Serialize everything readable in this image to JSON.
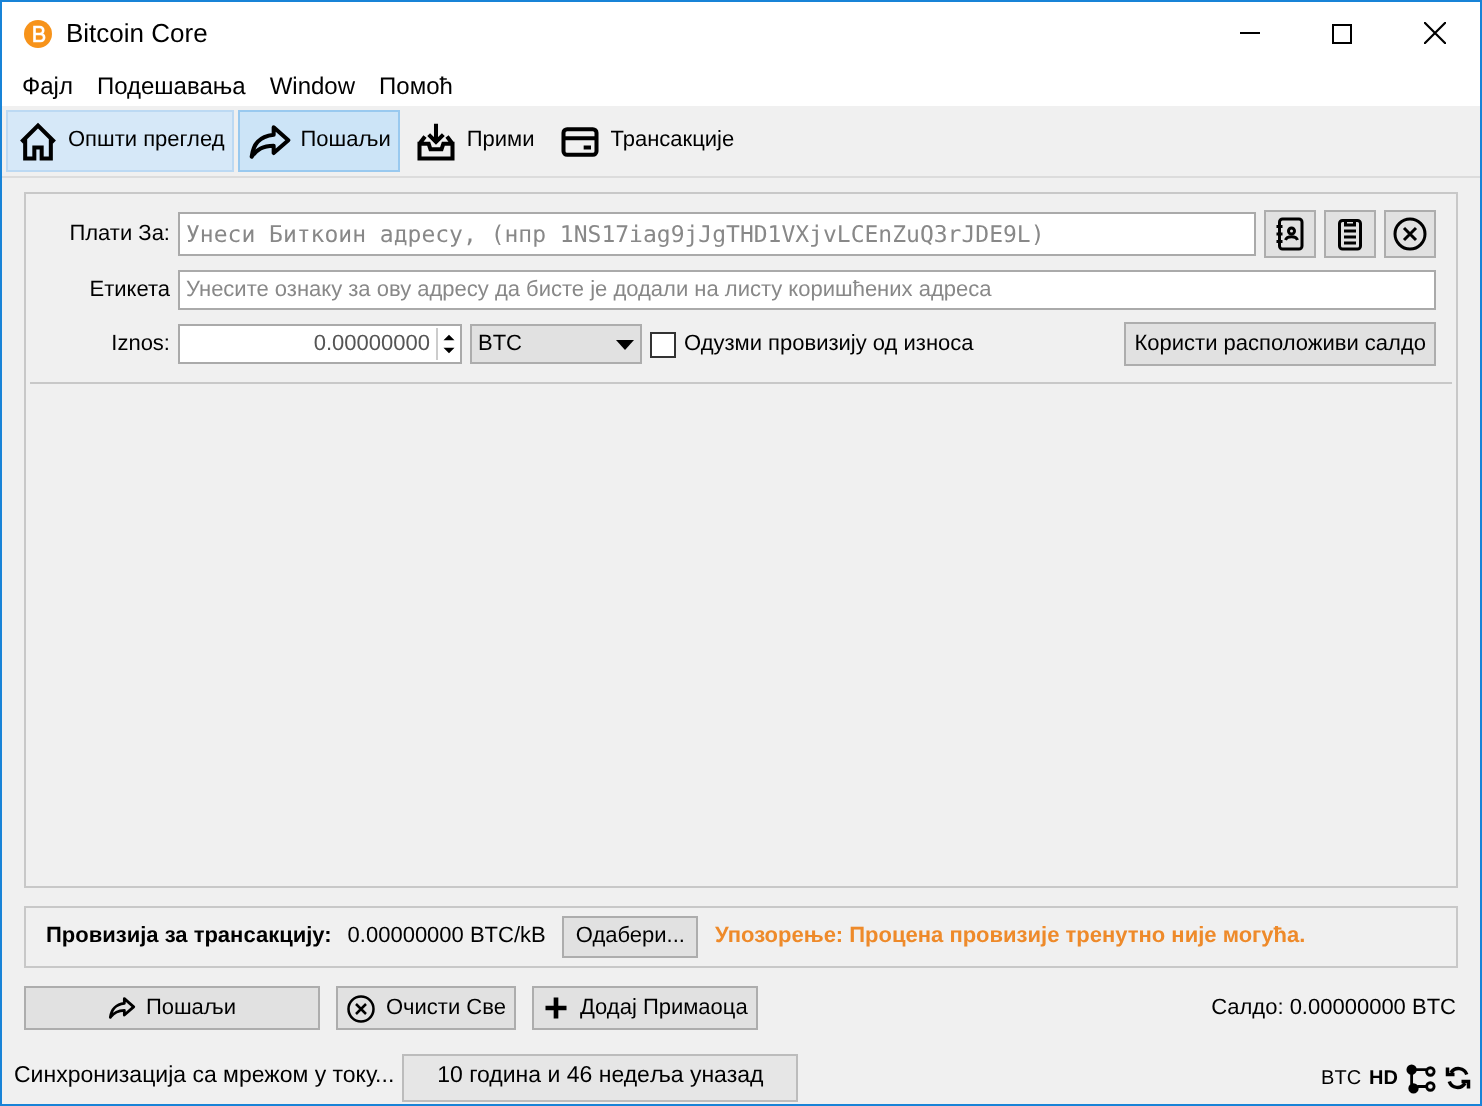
{
  "window": {
    "title": "Bitcoin Core"
  },
  "menu": [
    "Фајл",
    "Подешавања",
    "Window",
    "Помоћ"
  ],
  "tabs": [
    {
      "label": "Општи преглед",
      "selected": false,
      "hovered": true
    },
    {
      "label": "Пошаљи",
      "selected": true,
      "hovered": false
    },
    {
      "label": "Прими",
      "selected": false,
      "hovered": false
    },
    {
      "label": "Трансакције",
      "selected": false,
      "hovered": false
    }
  ],
  "recipient": {
    "pay_to_label": "Плати За:",
    "pay_to_placeholder": "Унеси Биткоин адресу, (нпр 1NS17iag9jJgTHD1VXjvLCEnZuQ3rJDE9L)",
    "label_label": "Етикета",
    "label_placeholder": "Унесите ознаку за ову адресу да бисте је додали на листу коришћених адреса",
    "amount_label": "Iznos:",
    "amount": "0.00000000",
    "unit": "BTC",
    "subtract_fee": {
      "label": "Одузми провизију од износа",
      "checked": false
    },
    "use_balance_button": "Користи расположиви салдо"
  },
  "fee": {
    "label": "Провизија за трансакцију:",
    "value": "0.00000000 BTC/kB",
    "choose_button": "Одабери...",
    "warning": "Упозорење: Процена провизије тренутно није могућа."
  },
  "actions": [
    {
      "label": "Пошаљи"
    },
    {
      "label": "Очисти Све"
    },
    {
      "label": "Додај Примаоца"
    }
  ],
  "balance": "Салдо: 0.00000000 BTC",
  "status_bar": {
    "sync_text": "Синхронизација са мрежом у току...",
    "progress_text": "10 година и 46 недеља уназад",
    "level": 0,
    "unit": "BTC",
    "hd": "HD"
  }
}
